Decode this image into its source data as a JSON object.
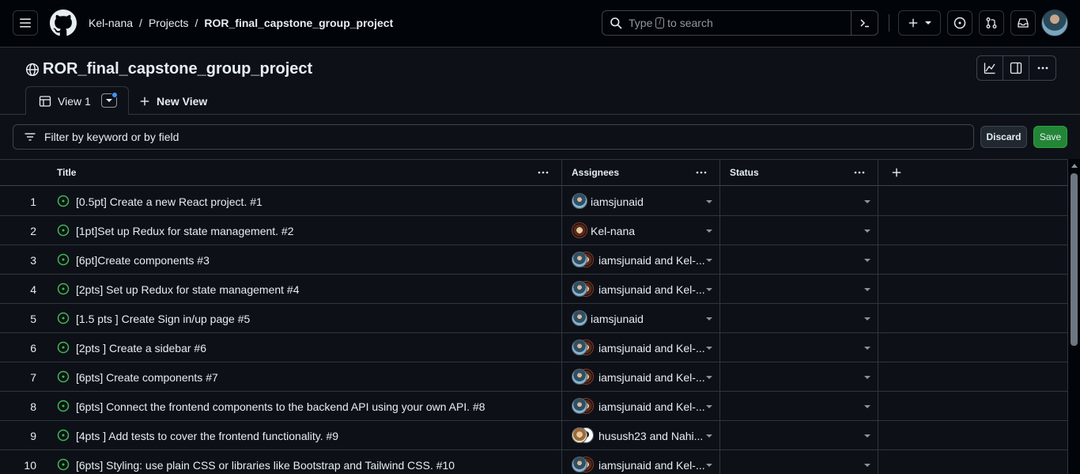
{
  "header": {
    "breadcrumbs": [
      "Kel-nana",
      "Projects",
      "ROR_final_capstone_group_project"
    ],
    "search_placeholder_before": "Type",
    "search_key": "/",
    "search_placeholder_after": "to search"
  },
  "project": {
    "title": "ROR_final_capstone_group_project"
  },
  "tabs": {
    "active_label": "View 1",
    "new_view_label": "New View"
  },
  "filter": {
    "placeholder": "Filter by keyword or by field",
    "discard_label": "Discard",
    "save_label": "Save"
  },
  "table": {
    "columns": [
      "Title",
      "Assignees",
      "Status"
    ],
    "rows": [
      {
        "num": "1",
        "title": "[0.5pt] Create a new React project.  #1",
        "assignees": "iamsjunaid",
        "avatars": [
          "junaid"
        ]
      },
      {
        "num": "2",
        "title": "[1pt]Set up Redux for state management.  #2",
        "assignees": "Kel-nana",
        "avatars": [
          "kel"
        ]
      },
      {
        "num": "3",
        "title": "[6pt]Create components  #3",
        "assignees": "iamsjunaid and Kel-...",
        "avatars": [
          "junaid",
          "kel"
        ]
      },
      {
        "num": "4",
        "title": "[2pts] Set up Redux for state management  #4",
        "assignees": "iamsjunaid and Kel-...",
        "avatars": [
          "junaid",
          "kel"
        ]
      },
      {
        "num": "5",
        "title": "[1.5 pts ] Create Sign in/up page  #5",
        "assignees": "iamsjunaid",
        "avatars": [
          "junaid"
        ]
      },
      {
        "num": "6",
        "title": "[2pts ] Create a sidebar  #6",
        "assignees": "iamsjunaid and Kel-...",
        "avatars": [
          "junaid",
          "kel"
        ]
      },
      {
        "num": "7",
        "title": "[6pts] Create components  #7",
        "assignees": "iamsjunaid and Kel-...",
        "avatars": [
          "junaid",
          "kel"
        ]
      },
      {
        "num": "8",
        "title": "[6pts] Connect the frontend components to the backend API using your own API.  #8",
        "assignees": "iamsjunaid and Kel-...",
        "avatars": [
          "junaid",
          "kel"
        ]
      },
      {
        "num": "9",
        "title": "[4pts ] Add tests to cover the frontend functionality.  #9",
        "assignees": "husush23 and Nahi...",
        "avatars": [
          "husush",
          "nahi"
        ]
      },
      {
        "num": "10",
        "title": "[6pts] Styling: use plain CSS or libraries like Bootstrap and Tailwind CSS.  #10",
        "assignees": "iamsjunaid and Kel-...",
        "avatars": [
          "junaid",
          "kel"
        ]
      }
    ]
  },
  "colors": {
    "background": "#0d1117",
    "header_background": "#010409",
    "border": "#30363d",
    "open_issue": "#3fb950",
    "save_button": "#238636",
    "accent_dot": "#4493f8"
  },
  "icons": [
    "hamburger-menu-icon",
    "github-logo-icon",
    "search-icon",
    "command-palette-icon",
    "plus-icon",
    "chevron-down-icon",
    "issue-opened-icon",
    "git-pull-request-icon",
    "inbox-icon",
    "globe-icon",
    "insights-graph-icon",
    "side-panel-icon",
    "kebab-horizontal-icon",
    "table-icon",
    "filter-icon"
  ]
}
